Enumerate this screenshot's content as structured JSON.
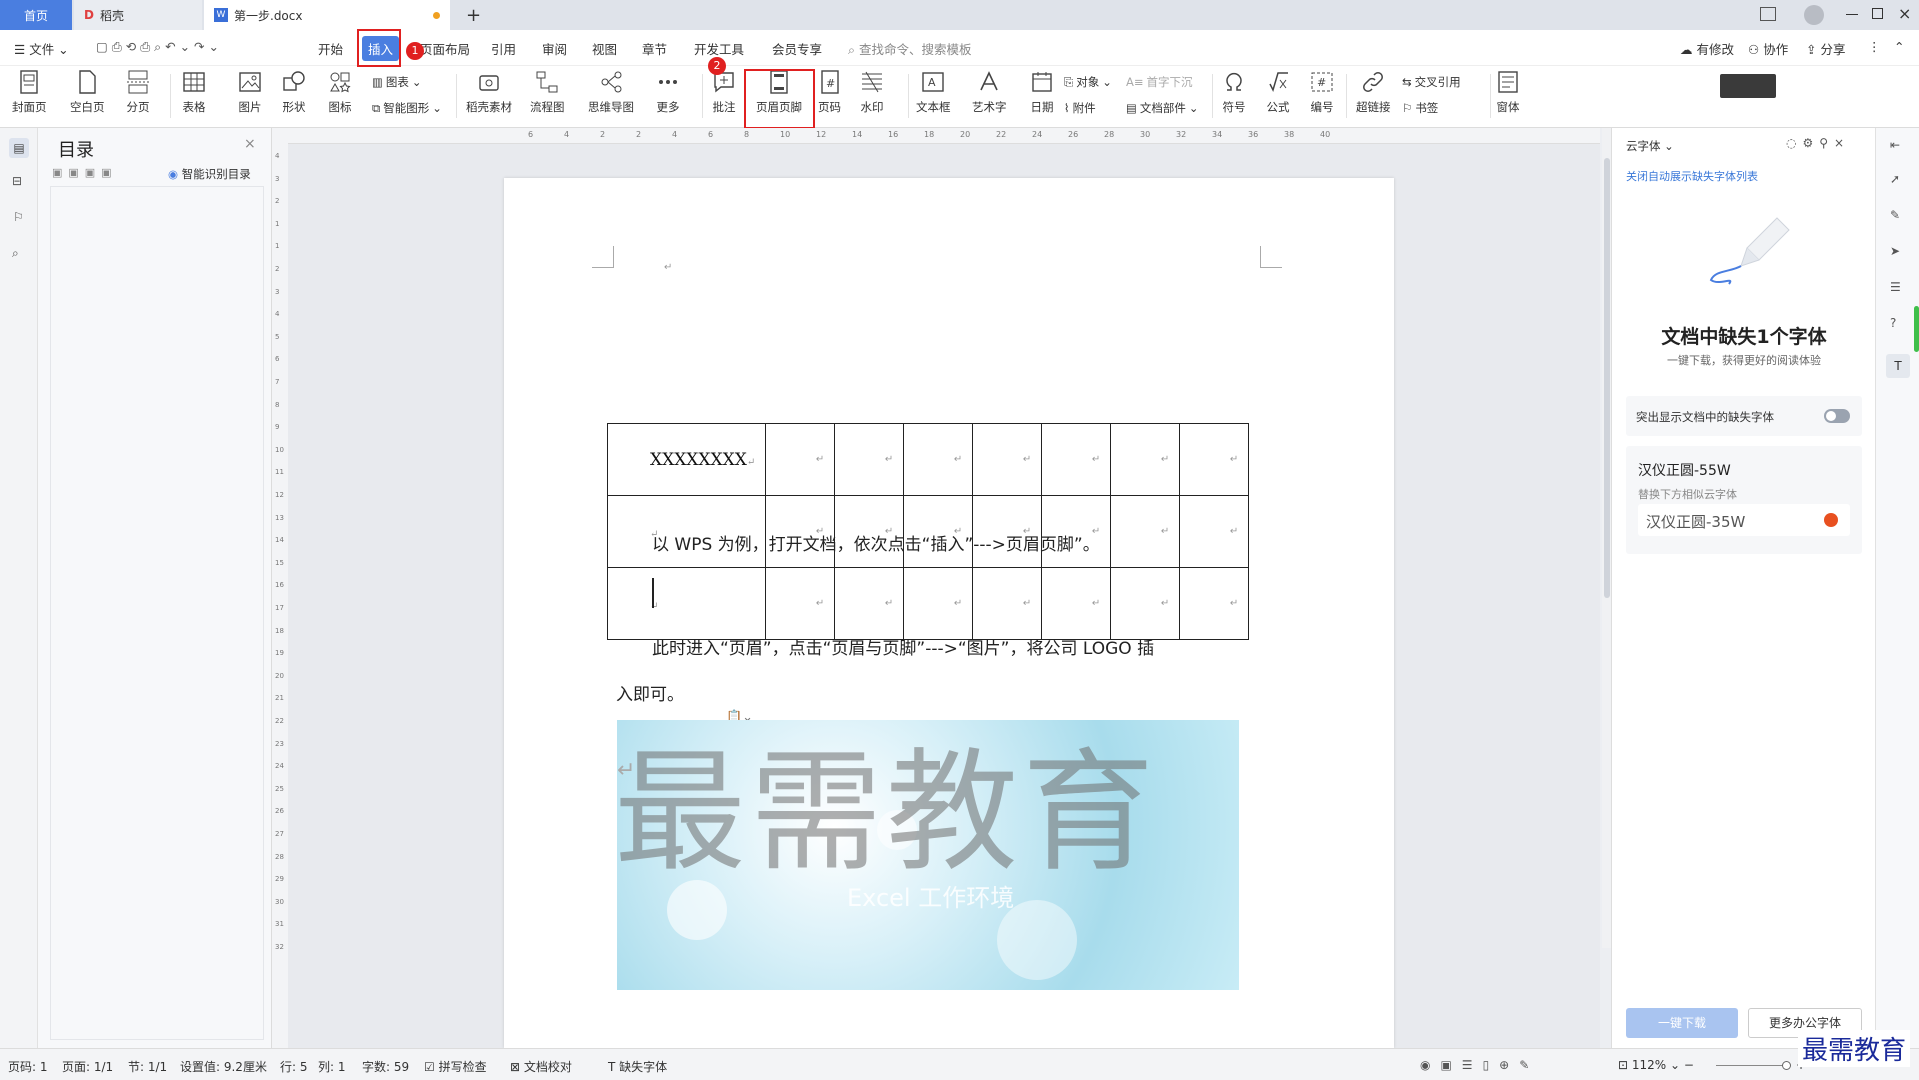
{
  "tabs": {
    "home": "首页",
    "daoke": "稻壳",
    "doc": "第一步.docx",
    "add": "+"
  },
  "menu": {
    "file": "文件",
    "items": [
      "开始",
      "插入",
      "页面布局",
      "引用",
      "审阅",
      "视图",
      "章节",
      "开发工具",
      "会员专享"
    ],
    "search": "查找命令、搜索模板",
    "right": [
      "有修改",
      "协作",
      "分享"
    ]
  },
  "ribbon": {
    "cover": "封面页",
    "blank": "空白页",
    "pagebreak": "分页",
    "table": "表格",
    "picture": "图片",
    "shape": "形状",
    "icon": "图标",
    "chart": "图表",
    "smartart": "智能图形",
    "daoke_material": "稻壳素材",
    "flowchart": "流程图",
    "mindmap": "思维导图",
    "more": "更多",
    "comment": "批注",
    "headerfooter": "页眉页脚",
    "pagenum": "页码",
    "watermark": "水印",
    "textbox": "文本框",
    "wordart": "艺术字",
    "date": "日期",
    "object": "对象",
    "attach": "附件",
    "dropcap": "首字下沉",
    "docpart": "文档部件",
    "symbol": "符号",
    "formula": "公式",
    "numbering": "编号",
    "hyperlink": "超链接",
    "crossref": "交叉引用",
    "bookmark": "书签",
    "window": "窗体"
  },
  "annotations": {
    "step1": "1",
    "step2": "2"
  },
  "toc": {
    "title": "目录",
    "smart": "智能识别目录"
  },
  "document": {
    "cell1": "XXXXXXXX",
    "para1": "以 WPS 为例，打开文档，依次点击“插入”--->页眉页脚”。",
    "para2a": "此时进入“页眉”，点击“页眉与页脚”--->“图片”，将公司 LOGO 插",
    "para2b": "入即可。",
    "watermark": "最需教育",
    "img_caption": "Excel 工作环境"
  },
  "cloudfont": {
    "tab": "云字体",
    "close_auto": "关闭自动展示缺失字体列表",
    "headline": "文档中缺失1个字体",
    "sub": "一键下载，获得更好的阅读体验",
    "highlight": "突出显示文档中的缺失字体",
    "missing_font": "汉仪正圆-55W",
    "replace_hint": "替换下方相似云字体",
    "replacement": "汉仪正圆-35W",
    "download": "一键下载",
    "more": "更多办公字体"
  },
  "status": {
    "page": "页码: 1",
    "pages": "页面: 1/1",
    "section": "节: 1/1",
    "setting": "设置值: 9.2厘米",
    "row": "行: 5",
    "col": "列: 1",
    "words": "字数: 59",
    "spell": "拼写检查",
    "proof": "文档校对",
    "missing": "缺失字体",
    "zoom": "112%"
  },
  "brand": "最需教育",
  "ruler_h": [
    "6",
    "4",
    "2",
    "2",
    "4",
    "6",
    "8",
    "10",
    "12",
    "14",
    "16",
    "18",
    "20",
    "22",
    "24",
    "26",
    "28",
    "30",
    "32",
    "34",
    "36",
    "38",
    "40"
  ],
  "ruler_v": [
    "4",
    "3",
    "2",
    "1",
    "1",
    "2",
    "3",
    "4",
    "5",
    "6",
    "7",
    "8",
    "9",
    "10",
    "11",
    "12",
    "13",
    "14",
    "15",
    "16",
    "17",
    "18",
    "19",
    "20",
    "21",
    "22",
    "23",
    "24",
    "25",
    "26",
    "27",
    "28",
    "29",
    "30",
    "31",
    "32"
  ],
  "colors": {
    "accent": "#4a7ee0",
    "annotation": "#e02020"
  }
}
